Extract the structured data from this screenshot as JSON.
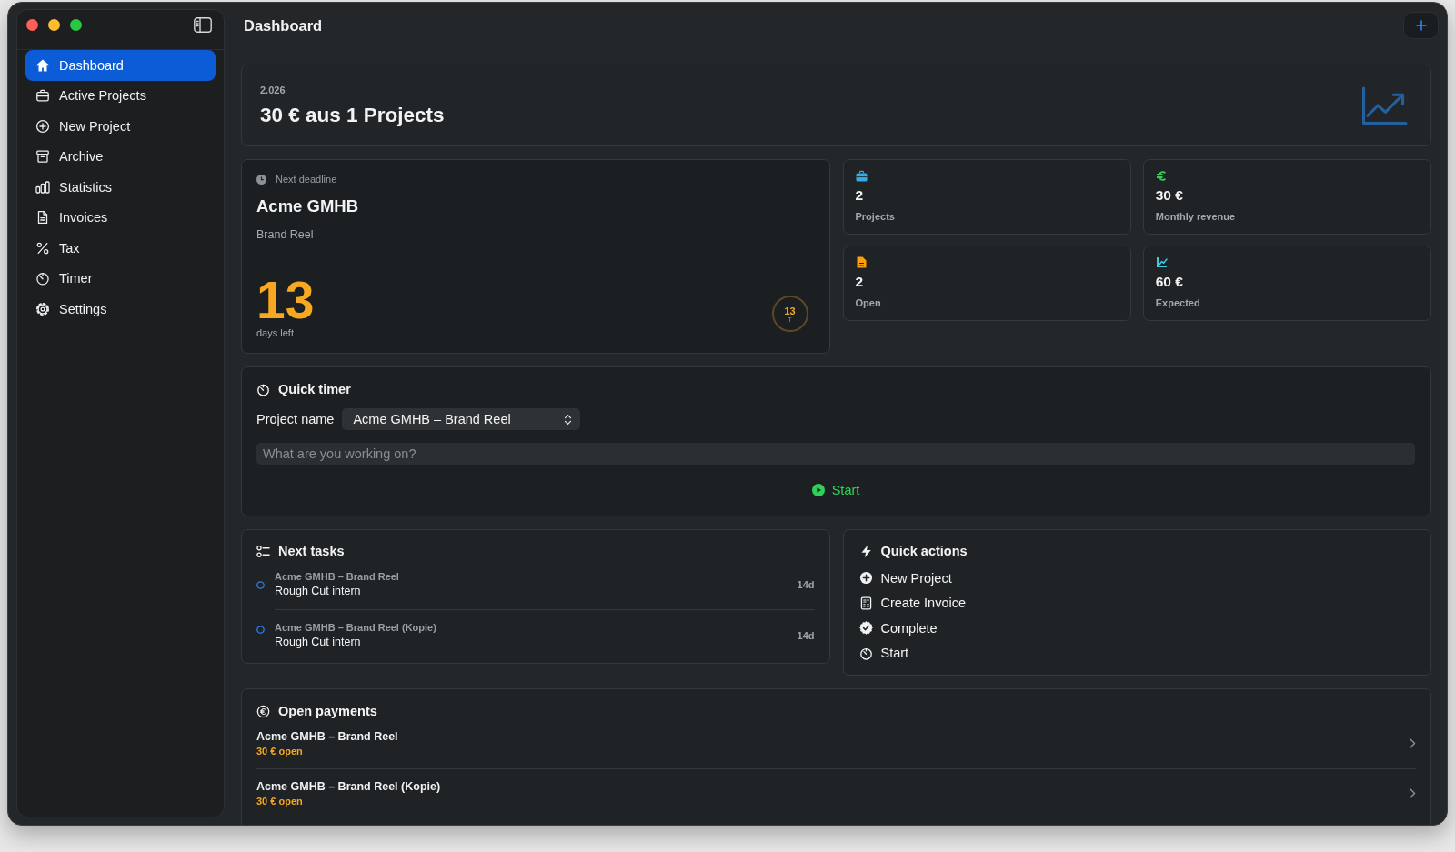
{
  "sidebar": {
    "items": [
      {
        "label": "Dashboard",
        "selected": true
      },
      {
        "label": "Active Projects",
        "selected": false
      },
      {
        "label": "New Project",
        "selected": false
      },
      {
        "label": "Archive",
        "selected": false
      },
      {
        "label": "Statistics",
        "selected": false
      },
      {
        "label": "Invoices",
        "selected": false
      },
      {
        "label": "Tax",
        "selected": false
      },
      {
        "label": "Timer",
        "selected": false
      },
      {
        "label": "Settings",
        "selected": false
      }
    ]
  },
  "header": {
    "title": "Dashboard"
  },
  "summary": {
    "year": "2.026",
    "headline": "30 € aus 1 Projects"
  },
  "deadline": {
    "caption": "Next deadline",
    "client": "Acme GMHB",
    "project": "Brand Reel",
    "days": "13",
    "days_caption": "days left",
    "ring_value": "13",
    "ring_unit": "T"
  },
  "stats": [
    {
      "color": "#32ade6",
      "value": "2",
      "label": "Projects"
    },
    {
      "color": "#30d158",
      "value": "30 €",
      "label": "Monthly revenue"
    },
    {
      "color": "#ff9f0a",
      "value": "2",
      "label": "Open"
    },
    {
      "color": "#40c8e0",
      "value": "60 €",
      "label": "Expected"
    }
  ],
  "quick_timer": {
    "title": "Quick timer",
    "project_label": "Project name",
    "project_value": "Acme GMHB – Brand Reel",
    "note_placeholder": "What are you working on?",
    "start_label": "Start"
  },
  "next_tasks": {
    "title": "Next tasks",
    "items": [
      {
        "project": "Acme GMHB – Brand Reel",
        "task": "Rough Cut intern",
        "due": "14d",
        "done": false
      },
      {
        "project": "Acme GMHB – Brand Reel (Kopie)",
        "task": "Rough Cut intern",
        "due": "14d",
        "done": false
      }
    ]
  },
  "quick_actions": {
    "title": "Quick actions",
    "items": [
      {
        "label": "New Project"
      },
      {
        "label": "Create Invoice"
      },
      {
        "label": "Complete"
      },
      {
        "label": "Start"
      }
    ]
  },
  "open_payments": {
    "title": "Open payments",
    "items": [
      {
        "project": "Acme GMHB – Brand Reel",
        "amount": "30 € open"
      },
      {
        "project": "Acme GMHB – Brand Reel (Kopie)",
        "amount": "30 € open"
      }
    ]
  }
}
